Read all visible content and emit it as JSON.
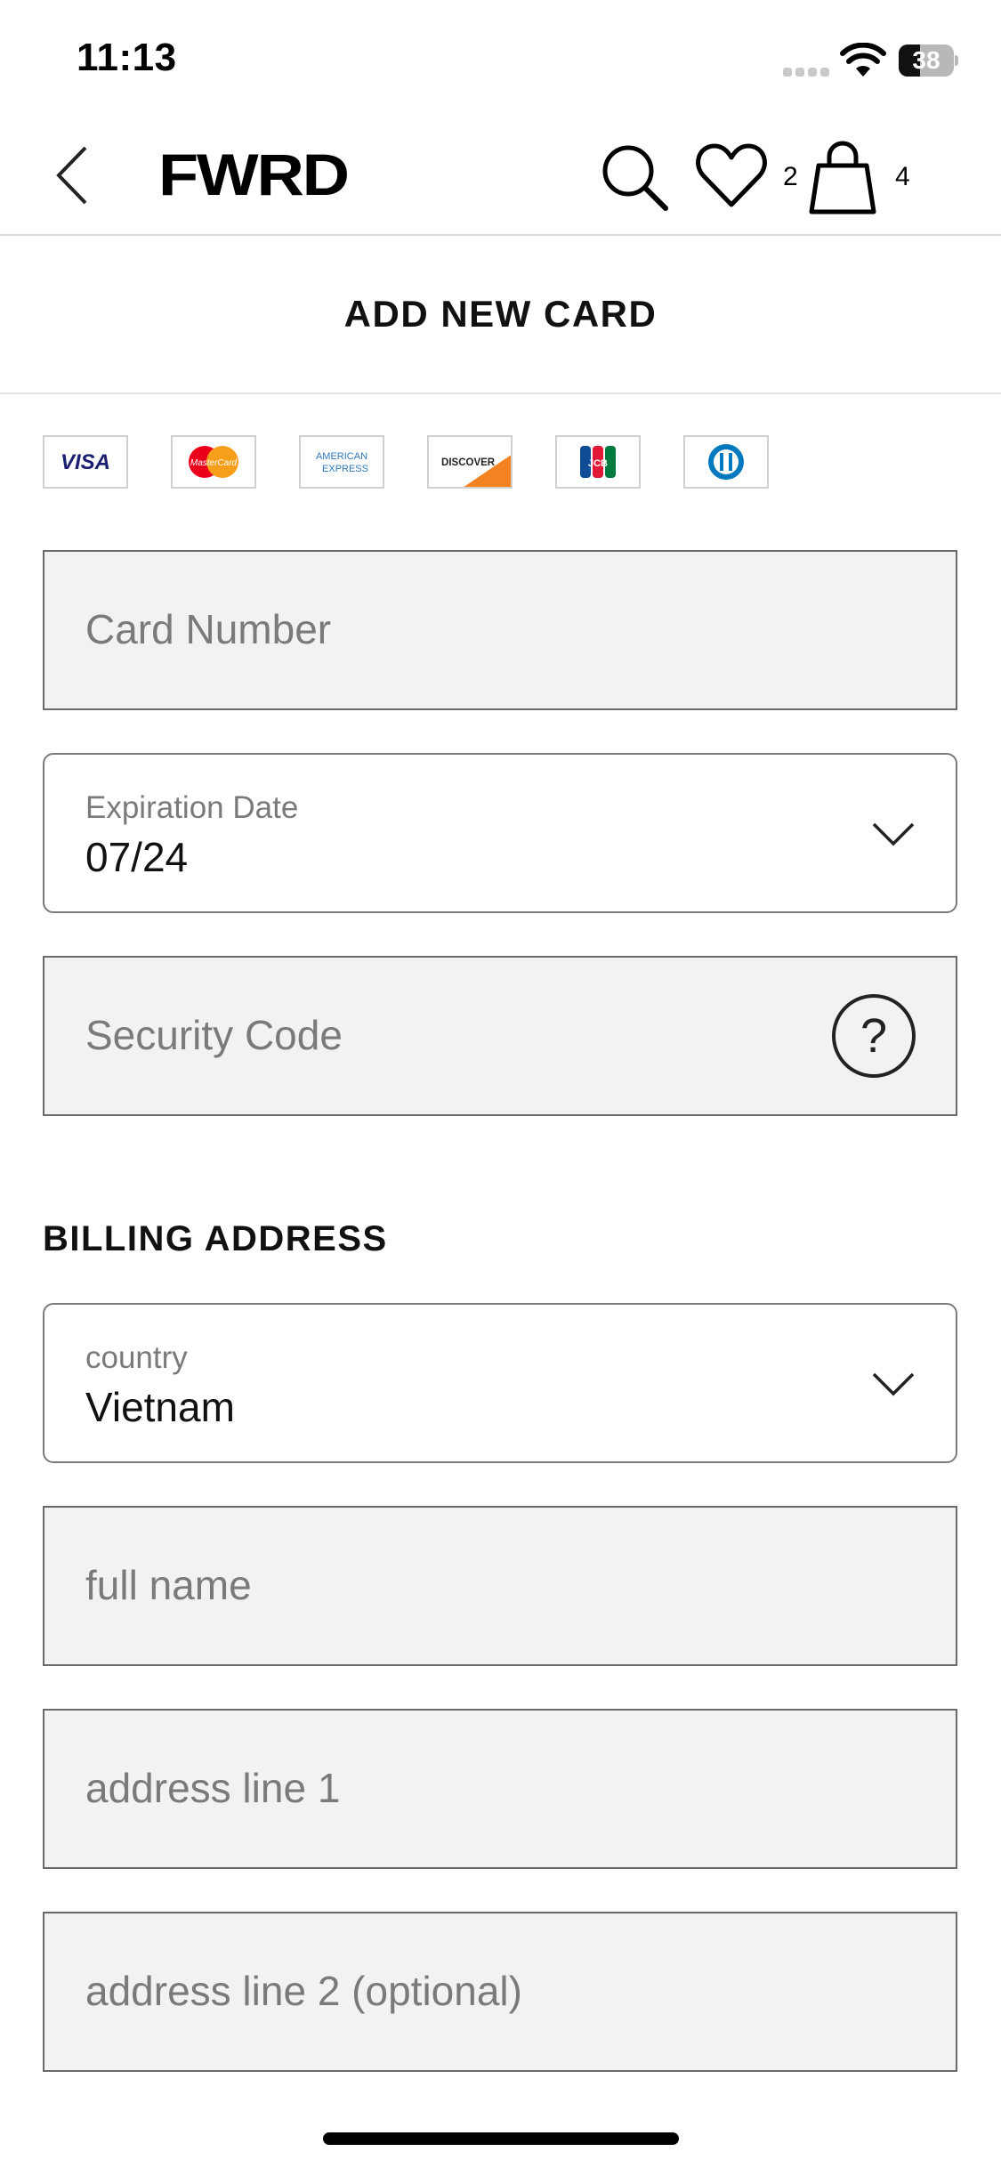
{
  "status_bar": {
    "time": "11:13",
    "battery": "38",
    "battery_level": 0.38
  },
  "nav": {
    "logo": "FWRD",
    "wishlist_count": "2",
    "bag_count": "4",
    "icons": [
      "back-arrow-icon",
      "search-icon",
      "heart-icon",
      "shopping-bag-icon"
    ]
  },
  "page": {
    "title": "ADD NEW CARD"
  },
  "card_logos": [
    {
      "name": "visa",
      "text": "VISA",
      "color": "#1a1f71"
    },
    {
      "name": "mastercard",
      "text": "MasterCard",
      "color": "#eb001b"
    },
    {
      "name": "american-express",
      "text": "AMERICAN EXPRESS",
      "color": "#2e77bb"
    },
    {
      "name": "discover",
      "text": "DISCOVER",
      "color": "#f58220"
    },
    {
      "name": "jcb",
      "text": "JCB",
      "color": "#0e4c96"
    },
    {
      "name": "diners-club",
      "text": "",
      "color": "#0079be"
    }
  ],
  "card_form": {
    "card_number_placeholder": "Card Number",
    "expiration_label": "Expiration Date",
    "expiration_value": "07/24",
    "security_code_placeholder": "Security Code"
  },
  "billing": {
    "title": "BILLING ADDRESS",
    "country_label": "country",
    "country_value": "Vietnam",
    "full_name_placeholder": "full name",
    "address1_placeholder": "address line 1",
    "address2_placeholder": "address line 2 (optional)"
  }
}
